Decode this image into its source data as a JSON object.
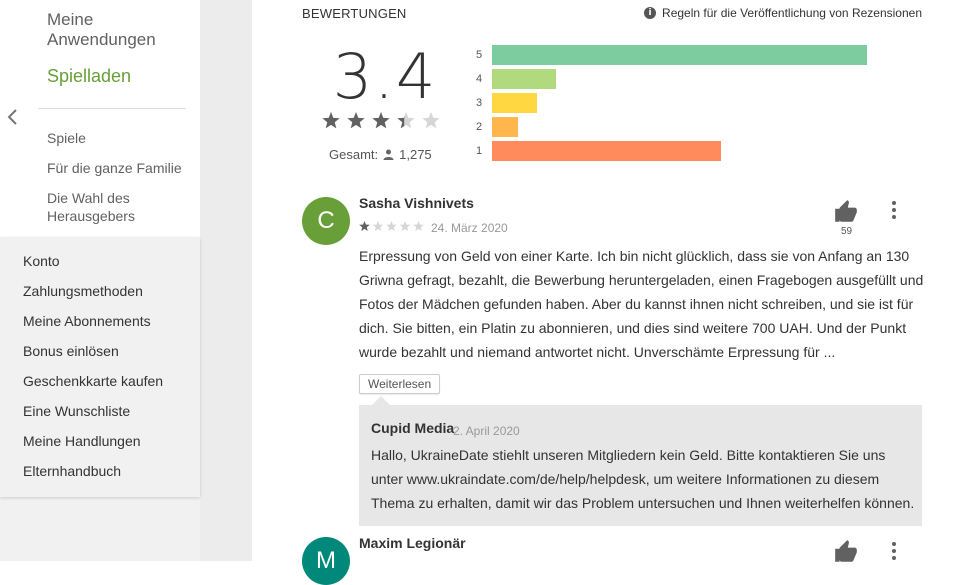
{
  "sidebar": {
    "my_apps_line1": "Meine",
    "my_apps_line2": "Anwendungen",
    "store": "Spielladen",
    "subnav": {
      "games": "Spiele",
      "family": "Für die ganze Familie",
      "editors_line1": "Die Wahl des",
      "editors_line2": "Herausgebers"
    },
    "account_items": [
      "Konto",
      "Zahlungsmethoden",
      "Meine Abonnements",
      "Bonus einlösen",
      "Geschenkkarte kaufen",
      "Eine Wunschliste",
      "Meine Handlungen",
      "Elternhandbuch"
    ]
  },
  "ratings": {
    "section_title": "BEWERTUNGEN",
    "policy_link": "Regeln für die Veröffentlichung von Rezensionen",
    "score": "3.4",
    "stars_fraction": 0.68,
    "total_label": "Gesamt:",
    "total_count": "1,275",
    "histogram": [
      {
        "label": "5",
        "relative": 1.0,
        "color": "#7ccca0"
      },
      {
        "label": "4",
        "relative": 0.17,
        "color": "#b1d97d"
      },
      {
        "label": "3",
        "relative": 0.12,
        "color": "#ffd740"
      },
      {
        "label": "2",
        "relative": 0.07,
        "color": "#ffb74d"
      },
      {
        "label": "1",
        "relative": 0.61,
        "color": "#ff8a5c"
      }
    ]
  },
  "reviews": [
    {
      "initial": "C",
      "avatar_color": "#689f38",
      "name": "Sasha Vishnivets",
      "stars": 1,
      "date": "24. März 2020",
      "helpful": "59",
      "text": "Erpressung von Geld von einer Karte. Ich bin nicht glücklich, dass sie von Anfang an 130 Griwna gefragt, bezahlt, die Bewerbung heruntergeladen, einen Fragebogen ausgefüllt und Fotos der Mädchen gefunden haben. Aber du kannst ihnen nicht schreiben, und sie ist für dich. Sie bitten, ein Platin zu abonnieren, und dies sind weitere 700 UAH. Und der Punkt wurde bezahlt und niemand antwortet nicht. Unverschämte Erpressung für ...",
      "more_label": "Weiterlesen",
      "reply": {
        "developer": "Cupid Media",
        "date": "2. April 2020",
        "text": "Hallo, UkraineDate stiehlt unseren Mitgliedern kein Geld. Bitte kontaktieren Sie uns unter www.ukraindate.com/de/help/helpdesk, um weitere Informationen zu diesem Thema zu erhalten, damit wir das Problem untersuchen und Ihnen weiterhelfen können."
      }
    },
    {
      "initial": "M",
      "avatar_color": "#00897b",
      "name": "Maxim Legionär"
    }
  ],
  "icons": {
    "back": "chevron-left-icon",
    "info": "info-icon",
    "person": "person-icon",
    "thumb": "thumb-up-icon",
    "menu": "more-vert-icon",
    "star": "star-icon"
  }
}
